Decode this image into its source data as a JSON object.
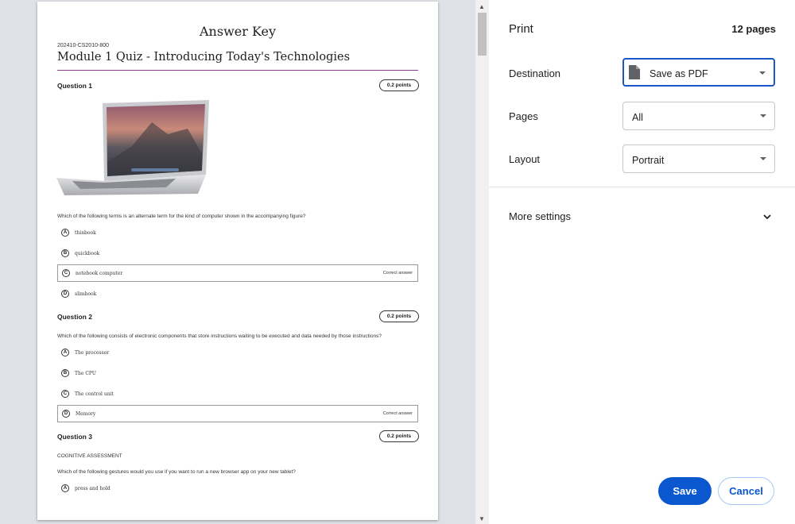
{
  "document": {
    "title": "Answer Key",
    "course_code": "202410-CS2010-800",
    "quiz_title": "Module 1 Quiz - Introducing Today's Technologies",
    "correct_label": "Correct answer",
    "questions": [
      {
        "heading": "Question 1",
        "points": "0.2 points",
        "text": "Which of the following terms is an alternate term for the kind of computer shown in the accompanying figure?",
        "options": [
          {
            "letter": "A",
            "text": "thinbook"
          },
          {
            "letter": "B",
            "text": "quickbook"
          },
          {
            "letter": "C",
            "text": "notebook computer"
          },
          {
            "letter": "D",
            "text": "slimbook"
          }
        ]
      },
      {
        "heading": "Question 2",
        "points": "0.2 points",
        "text": "Which of the following consists of electronic components that store instructions waiting to be executed and data needed by those instructions?",
        "options": [
          {
            "letter": "A",
            "text": "The processor"
          },
          {
            "letter": "B",
            "text": "The CPU"
          },
          {
            "letter": "C",
            "text": "The control unit"
          },
          {
            "letter": "D",
            "text": "Memory"
          }
        ]
      },
      {
        "heading": "Question 3",
        "points": "0.2 points",
        "category": "COGNITIVE ASSESSMENT",
        "text": "Which of the following gestures would you use if you want to run a new browser app on your new tablet?",
        "options": [
          {
            "letter": "A",
            "text": "press and hold"
          }
        ]
      }
    ]
  },
  "print_panel": {
    "title": "Print",
    "page_count": "12 pages",
    "destination_label": "Destination",
    "destination_value": "Save as PDF",
    "pages_label": "Pages",
    "pages_value": "All",
    "layout_label": "Layout",
    "layout_value": "Portrait",
    "more_settings": "More settings",
    "save_button": "Save",
    "cancel_button": "Cancel"
  },
  "icons": {
    "destination": "file-icon",
    "dropdown": "caret-down-icon",
    "more_settings": "chevron-down-icon"
  },
  "colors": {
    "accent": "#0b57d0",
    "title_rule": "#8e3b8f"
  }
}
